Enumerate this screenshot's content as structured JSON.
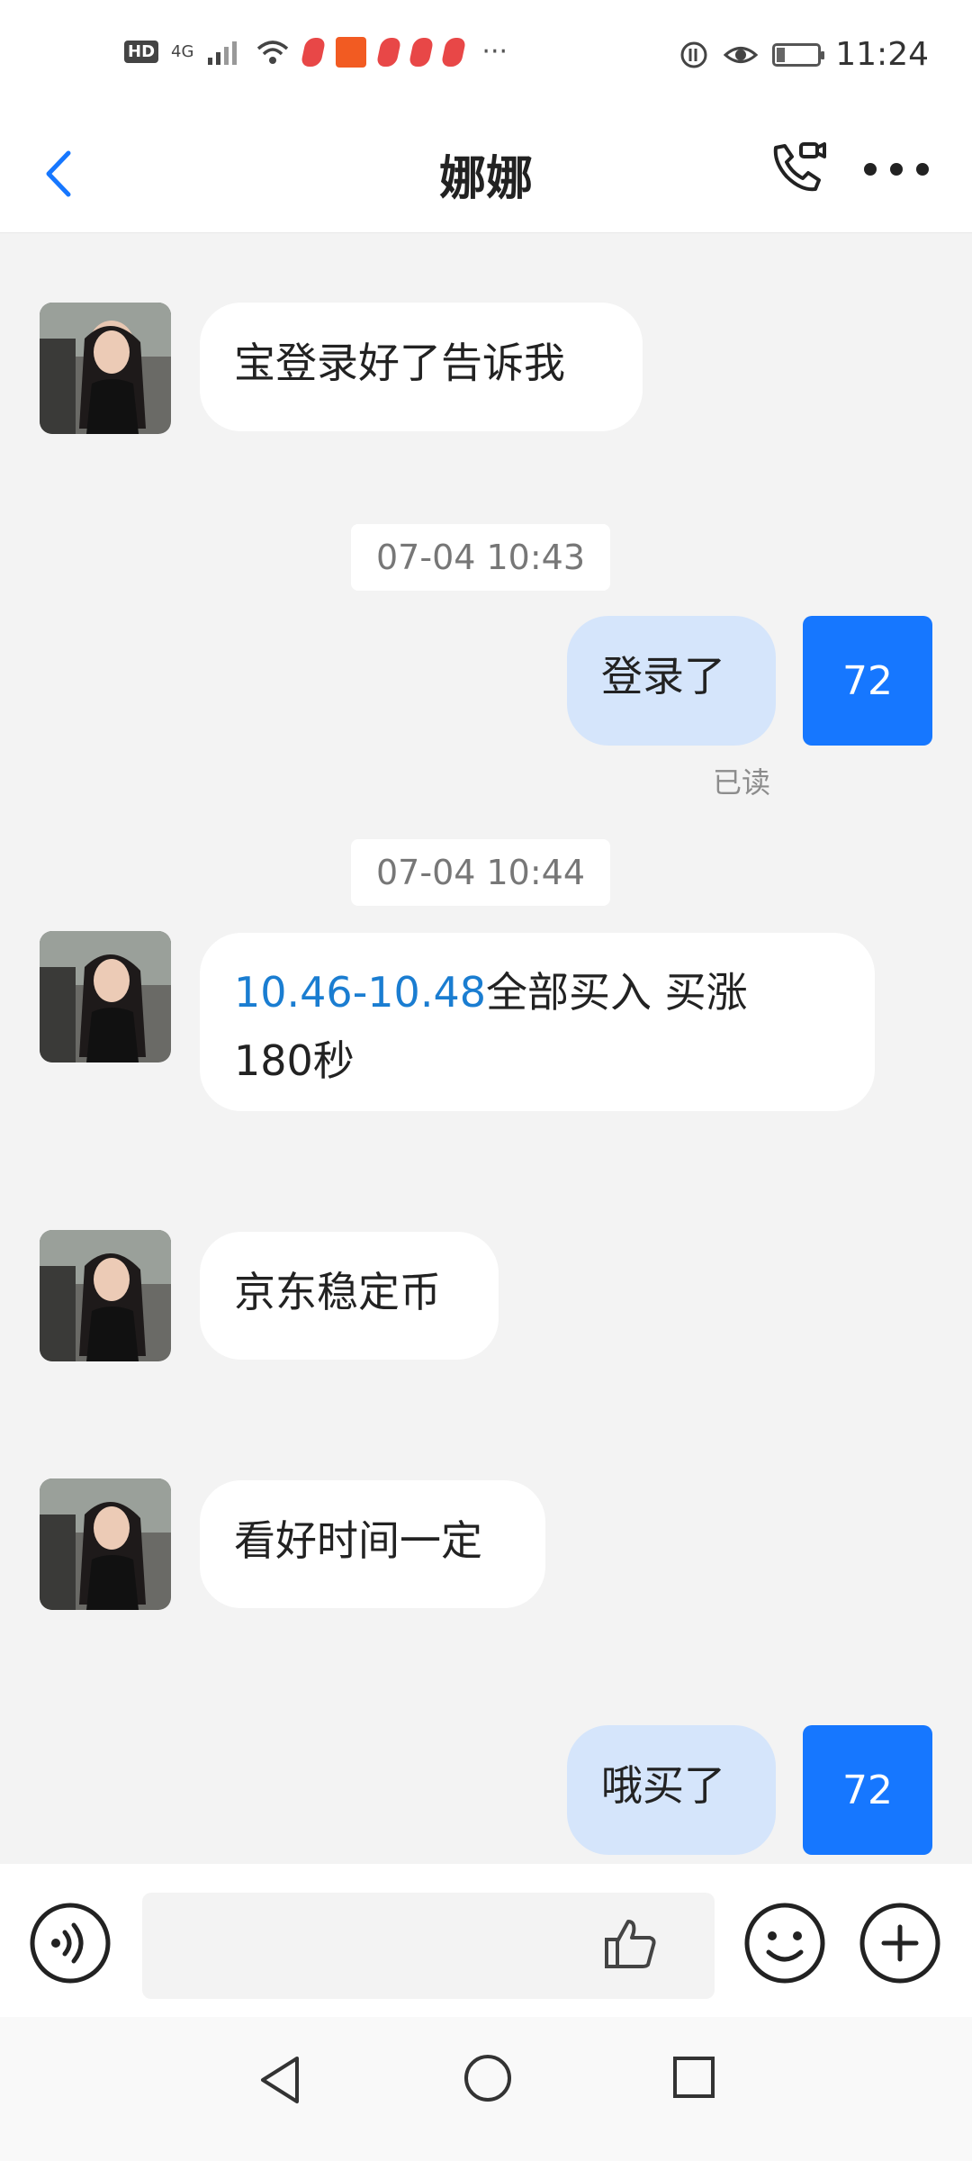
{
  "status_bar": {
    "hd": "HD",
    "network": "4G",
    "dots": "···",
    "time": "11:24",
    "battery_level": 0.2
  },
  "header": {
    "title": "娜娜"
  },
  "messages": [
    {
      "type": "text",
      "side": "left",
      "text": "宝登录好了告诉我"
    },
    {
      "type": "timestamp",
      "text": "07-04 10:43"
    },
    {
      "type": "text",
      "side": "right",
      "text": "登录了",
      "badge": "72",
      "status": "已读"
    },
    {
      "type": "timestamp",
      "text": "07-04 10:44"
    },
    {
      "type": "text",
      "side": "left",
      "highlight": "10.46-10.48",
      "text_line1": "全部买入 买涨",
      "text_line2": "180秒"
    },
    {
      "type": "text",
      "side": "left",
      "text": "京东稳定币"
    },
    {
      "type": "text",
      "side": "left",
      "text": "看好时间一定"
    },
    {
      "type": "text",
      "side": "right",
      "text": "哦买了",
      "badge": "72"
    }
  ],
  "colors": {
    "accent_blue": "#1677ff",
    "bubble_right": "#d5e5fb",
    "background": "#f3f3f3"
  }
}
